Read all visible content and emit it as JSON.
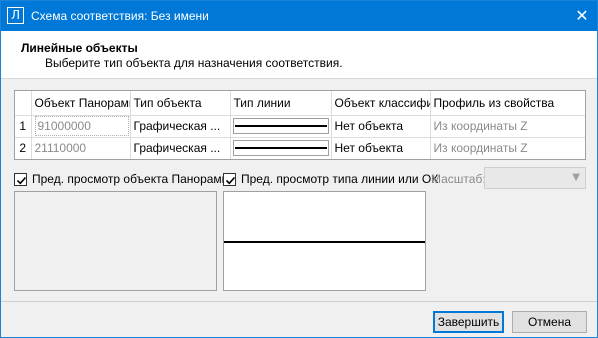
{
  "window": {
    "title": "Схема соответствия: Без имени",
    "app_icon_glyph": "Л",
    "close_glyph": "✕"
  },
  "header": {
    "title": "Линейные объекты",
    "subtitle": "Выберите тип объекта для назначения соответствия."
  },
  "table": {
    "columns": [
      "",
      "Объект Панорамы",
      "Тип объекта",
      "Тип линии",
      "Объект классификатора",
      "Профиль из свойства"
    ],
    "rows": [
      {
        "num": "1",
        "code": "91000000",
        "type": "Графическая ...",
        "line": "solid",
        "classifier": "Нет объекта",
        "profile": "Из координаты Z"
      },
      {
        "num": "2",
        "code": "21110000",
        "type": "Графическая ...",
        "line": "solid",
        "classifier": "Нет объекта",
        "profile": "Из координаты Z"
      }
    ]
  },
  "options": {
    "preview_object_label": "Пред. просмотр объекта Панорамы",
    "preview_object_checked": true,
    "preview_line_label": "Пред. просмотр типа линии или ОК",
    "preview_line_checked": true,
    "scale_label": "Масштаб:",
    "scale_value": ""
  },
  "buttons": {
    "finish_label": "Завершить",
    "cancel_label": "Отмена"
  },
  "colors": {
    "titlebar": "#0078d7",
    "accent": "#0078d7"
  }
}
